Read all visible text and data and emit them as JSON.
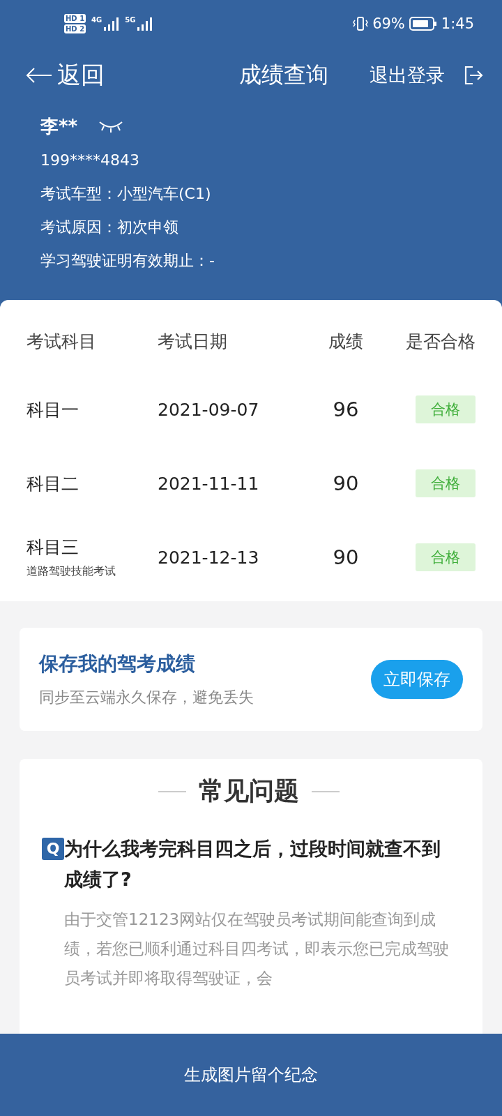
{
  "status_bar": {
    "sims": [
      "HD 1",
      "HD 2"
    ],
    "networks": [
      "4G",
      "5G"
    ],
    "battery": "69%",
    "time": "1:45"
  },
  "nav": {
    "back": "返回",
    "title": "成绩查询",
    "logout": "退出登录"
  },
  "profile": {
    "name": "李**",
    "phone": "199****4843",
    "lines": [
      {
        "label": "考试车型：",
        "value": "小型汽车(C1)"
      },
      {
        "label": "考试原因：",
        "value": "初次申领"
      },
      {
        "label": "学习驾驶证明有效期止：",
        "value": "-"
      }
    ]
  },
  "table": {
    "columns": [
      "考试科目",
      "考试日期",
      "成绩",
      "是否合格"
    ],
    "rows": [
      {
        "subject": "科目一",
        "date": "2021-09-07",
        "score": "96",
        "result": "合格",
        "passed": true
      },
      {
        "subject": "科目二",
        "date": "2021-11-11",
        "score": "90",
        "result": "合格",
        "passed": true
      },
      {
        "subject": "科目三",
        "note": "道路驾驶技能考试",
        "date": "2021-12-13",
        "score": "90",
        "result": "合格",
        "passed": true
      }
    ]
  },
  "save_card": {
    "title": "保存我的驾考成绩",
    "subtitle": "同步至云端永久保存，避免丢失",
    "button": "立即保存"
  },
  "faq": {
    "title": "常见问题",
    "items": [
      {
        "badge": "Q",
        "question": "为什么我考完科目四之后，过段时间就查不到成绩了?",
        "answer": "由于交管12123网站仅在驾驶员考试期间能查询到成绩，若您已顺利通过科目四考试，即表示您已完成驾驶员考试并即将取得驾驶证，会"
      }
    ]
  },
  "bottom_button": "生成图片留个纪念"
}
